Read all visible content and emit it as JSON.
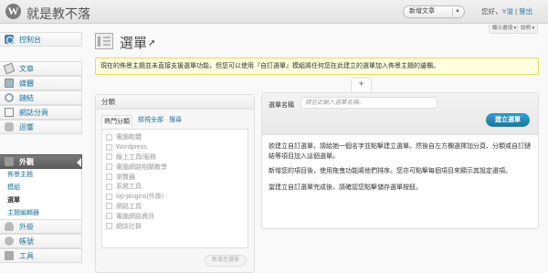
{
  "header": {
    "logo": "W",
    "site_title": "就是教不落",
    "new_post": "新增文章",
    "howdy_prefix": "您好，",
    "user": "Y溢",
    "logout": "登出"
  },
  "screen_options": "顯示選項",
  "help": "說明",
  "sidebar": {
    "items": [
      {
        "label": "控制台",
        "icon": "dashboard-icon"
      },
      {
        "label": "文章",
        "icon": "posts-icon"
      },
      {
        "label": "媒體",
        "icon": "media-icon"
      },
      {
        "label": "鏈結",
        "icon": "links-icon"
      },
      {
        "label": "網誌分頁",
        "icon": "pages-icon"
      },
      {
        "label": "迴響",
        "icon": "comments-icon"
      },
      {
        "label": "外觀",
        "icon": "appearance-icon"
      },
      {
        "label": "外掛",
        "icon": "plugins-icon"
      },
      {
        "label": "帳號",
        "icon": "users-icon"
      },
      {
        "label": "工具",
        "icon": "tools-icon"
      }
    ],
    "submenu": [
      "佈景主題",
      "模組",
      "選單",
      "主題編輯器"
    ]
  },
  "page": {
    "title": "選單",
    "notice": "現在的佈景主題並未直接支援選單功能，但您可以使用『自訂選單』模組將任何您在此建立的選單加入佈景主題的邊欄。"
  },
  "categories": {
    "title": "分類",
    "tabs": [
      "熱門分類",
      "檢視全部",
      "搜尋"
    ],
    "items": [
      "電腦軟體",
      "Wordpress",
      "線上工具/服務",
      "電腦網路相關教學",
      "瀏覽器",
      "系統工具",
      "wp-plugins(外掛)",
      "網路工具",
      "電腦網路資訊",
      "網誌社群"
    ],
    "add_button": "新增至選單"
  },
  "menu_editor": {
    "plus_tab": "+",
    "name_label": "選單名稱",
    "name_placeholder": "請在此輸入選單名稱。",
    "create_button": "建立選單",
    "instructions": [
      "欲建立自訂選單，請給她一個名字並點擊建立選單。然後自左方欄選擇加分頁、分類或自訂鏈結等項目加入這個選單。",
      "新增您的項目後，使用拖曳功能將他們排序。您亦可點擊每個項目來顯示其設定選項。",
      "當建立自訂選單完成後，請確認您點擊儲存選單按鈕。"
    ]
  }
}
